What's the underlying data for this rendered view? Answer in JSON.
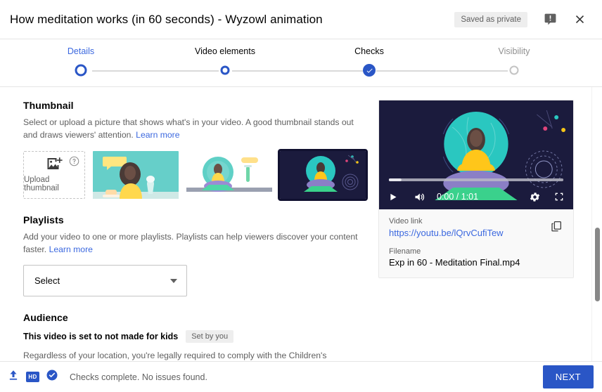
{
  "header": {
    "title": "How meditation works (in 60 seconds) - Wyzowl animation",
    "saved_badge": "Saved as private",
    "feedback_icon": "feedback-icon",
    "close_icon": "close-icon"
  },
  "stepper": {
    "steps": [
      {
        "label": "Details",
        "state": "active"
      },
      {
        "label": "Video elements",
        "state": "done"
      },
      {
        "label": "Checks",
        "state": "complete"
      },
      {
        "label": "Visibility",
        "state": "todo"
      }
    ]
  },
  "thumbnail": {
    "title": "Thumbnail",
    "description": "Select or upload a picture that shows what's in your video. A good thumbnail stands out and draws viewers' attention. ",
    "learn_more": "Learn more",
    "upload_label": "Upload thumbnail",
    "upload_icon": "add-image-icon",
    "help_icon": "help-circle-icon",
    "options": [
      {
        "name": "thumbnail-option-1",
        "selected": false
      },
      {
        "name": "thumbnail-option-2",
        "selected": false
      },
      {
        "name": "thumbnail-option-3",
        "selected": true
      }
    ]
  },
  "playlists": {
    "title": "Playlists",
    "description": "Add your video to one or more playlists. Playlists can help viewers discover your content faster. ",
    "learn_more": "Learn more",
    "select_value": "Select"
  },
  "audience": {
    "title": "Audience",
    "kids_status": "This video is set to not made for kids",
    "chip": "Set by you",
    "coppa_text": "Regardless of your location, you're legally required to comply with the Children's Online Privacy Protection Act (COPPA) and/or other laws. You're required to tell us whether your"
  },
  "video_card": {
    "player": {
      "play_icon": "play-icon",
      "volume_icon": "volume-icon",
      "time": "0:00 / 1:01",
      "settings_icon": "gear-icon",
      "fullscreen_icon": "fullscreen-icon"
    },
    "video_link_label": "Video link",
    "video_link": "https://youtu.be/lQrvCufiTew",
    "filename_label": "Filename",
    "filename": "Exp in 60 - Meditation Final.mp4",
    "copy_icon": "copy-icon"
  },
  "footer": {
    "upload_icon": "upload-arrow-icon",
    "hd_badge": "HD",
    "check_icon": "check-circle-icon",
    "status": "Checks complete. No issues found.",
    "next_label": "NEXT"
  },
  "colors": {
    "accent": "#2a56c6",
    "link": "#3b68df",
    "text": "#030303",
    "muted": "#606060"
  }
}
